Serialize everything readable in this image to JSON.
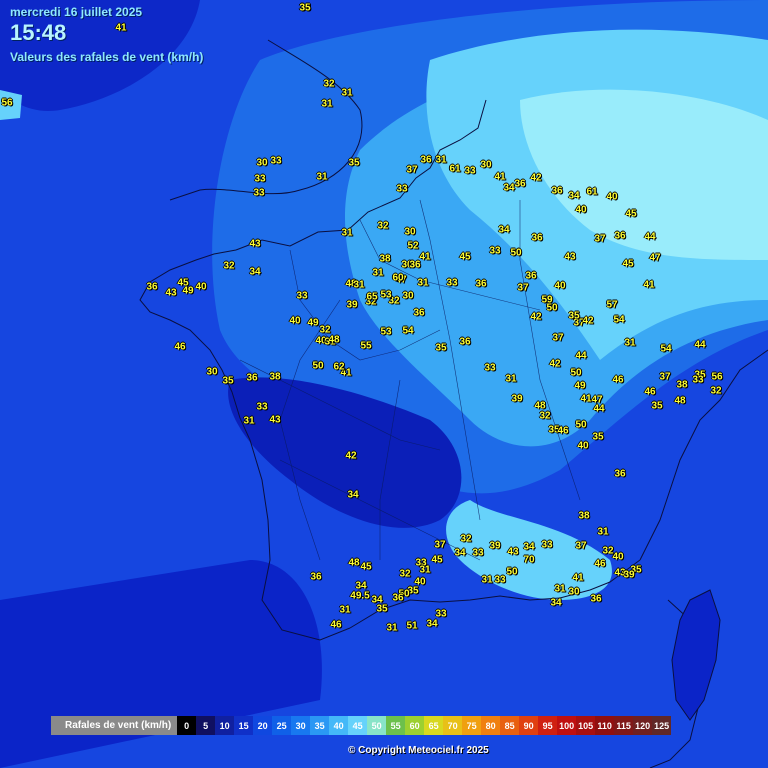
{
  "header": {
    "date": "mercredi 16 juillet 2025",
    "time": "15:48",
    "subtitle": "Valeurs des rafales de vent (km/h)"
  },
  "map": {
    "colors": {
      "sea": "#0a2fd6",
      "dark": "#0b1fb8",
      "mid": "#1e6ce8",
      "light": "#3aa8f4",
      "pale": "#66d2fb",
      "palest": "#99ecfb",
      "obs_text": "#ffff33"
    }
  },
  "observations": [
    {
      "v": "33"
    },
    {
      "v": "41"
    },
    {
      "v": "56"
    },
    {
      "v": "32"
    },
    {
      "v": "31"
    },
    {
      "v": "31"
    },
    {
      "v": "30"
    },
    {
      "v": "33"
    },
    {
      "v": "33"
    },
    {
      "v": "31"
    },
    {
      "v": "35"
    },
    {
      "v": "33"
    },
    {
      "v": "31"
    },
    {
      "v": "43"
    },
    {
      "v": "32"
    },
    {
      "v": "34"
    },
    {
      "v": "30"
    },
    {
      "v": "35"
    },
    {
      "v": "36"
    },
    {
      "v": "38"
    },
    {
      "v": "40"
    },
    {
      "v": "33"
    },
    {
      "v": "31"
    },
    {
      "v": "43"
    },
    {
      "v": "45"
    },
    {
      "v": "36"
    },
    {
      "v": "43"
    },
    {
      "v": "40"
    },
    {
      "v": "46"
    },
    {
      "v": "49"
    },
    {
      "v": "48"
    },
    {
      "v": "38"
    },
    {
      "v": "30"
    },
    {
      "v": "32"
    },
    {
      "v": "45"
    },
    {
      "v": "33"
    },
    {
      "v": "36"
    },
    {
      "v": "59"
    },
    {
      "v": "40"
    },
    {
      "v": "37"
    },
    {
      "v": "35"
    },
    {
      "v": "37"
    },
    {
      "v": "44"
    },
    {
      "v": "37"
    },
    {
      "v": "36"
    },
    {
      "v": "33"
    },
    {
      "v": "50"
    },
    {
      "v": "50"
    },
    {
      "v": "42"
    },
    {
      "v": "57"
    },
    {
      "v": "34"
    },
    {
      "v": "36"
    },
    {
      "v": "43"
    },
    {
      "v": "37"
    },
    {
      "v": "36"
    },
    {
      "v": "44"
    },
    {
      "v": "40"
    },
    {
      "v": "45"
    },
    {
      "v": "47"
    },
    {
      "v": "41"
    },
    {
      "v": "42"
    },
    {
      "v": "54"
    },
    {
      "v": "31"
    },
    {
      "v": "54"
    },
    {
      "v": "44"
    },
    {
      "v": "35"
    },
    {
      "v": "38"
    },
    {
      "v": "37"
    },
    {
      "v": "32"
    },
    {
      "v": "56"
    },
    {
      "v": "33"
    },
    {
      "v": "48"
    },
    {
      "v": "35"
    },
    {
      "v": "46"
    },
    {
      "v": "44"
    },
    {
      "v": "46"
    },
    {
      "v": "47"
    },
    {
      "v": "49"
    },
    {
      "v": "50"
    },
    {
      "v": "42"
    },
    {
      "v": "36"
    },
    {
      "v": "35"
    },
    {
      "v": "33"
    },
    {
      "v": "31"
    },
    {
      "v": "39"
    },
    {
      "v": "32"
    },
    {
      "v": "48"
    },
    {
      "v": "35"
    },
    {
      "v": "46"
    },
    {
      "v": "41"
    },
    {
      "v": "50"
    },
    {
      "v": "35"
    },
    {
      "v": "40"
    },
    {
      "v": "36"
    },
    {
      "v": "38"
    },
    {
      "v": "37"
    },
    {
      "v": "46"
    },
    {
      "v": "43"
    },
    {
      "v": "35"
    },
    {
      "v": "41"
    },
    {
      "v": "31"
    },
    {
      "v": "30"
    },
    {
      "v": "34"
    },
    {
      "v": "36"
    },
    {
      "v": "40"
    },
    {
      "v": "39"
    },
    {
      "v": "32"
    },
    {
      "v": "31"
    },
    {
      "v": "33"
    },
    {
      "v": "34"
    },
    {
      "v": "70"
    },
    {
      "v": "50"
    },
    {
      "v": "33"
    },
    {
      "v": "31"
    },
    {
      "v": "43"
    },
    {
      "v": "39"
    },
    {
      "v": "33"
    },
    {
      "v": "34"
    },
    {
      "v": "32"
    },
    {
      "v": "37"
    },
    {
      "v": "45"
    },
    {
      "v": "33"
    },
    {
      "v": "31"
    },
    {
      "v": "32"
    },
    {
      "v": "40"
    },
    {
      "v": "35"
    },
    {
      "v": "50"
    },
    {
      "v": "34"
    },
    {
      "v": "33"
    },
    {
      "v": "34"
    },
    {
      "v": "51"
    },
    {
      "v": "31"
    },
    {
      "v": "36"
    },
    {
      "v": "35"
    },
    {
      "v": "34"
    },
    {
      "v": "45"
    },
    {
      "v": "48"
    },
    {
      "v": "49.5"
    },
    {
      "v": "46"
    },
    {
      "v": "31"
    },
    {
      "v": "36"
    },
    {
      "v": "34"
    },
    {
      "v": "42"
    },
    {
      "v": "41"
    },
    {
      "v": "31"
    },
    {
      "v": "33"
    },
    {
      "v": "40"
    },
    {
      "v": "49"
    },
    {
      "v": "32"
    },
    {
      "v": "48"
    },
    {
      "v": "50"
    },
    {
      "v": "62"
    },
    {
      "v": "55"
    },
    {
      "v": "53"
    },
    {
      "v": "54"
    },
    {
      "v": "36"
    },
    {
      "v": "32"
    },
    {
      "v": "30"
    },
    {
      "v": "31"
    },
    {
      "v": "41"
    },
    {
      "v": "36"
    },
    {
      "v": "47"
    },
    {
      "v": "53"
    },
    {
      "v": "65"
    },
    {
      "v": "39"
    },
    {
      "v": "31"
    },
    {
      "v": "31"
    },
    {
      "v": "60"
    },
    {
      "v": "52"
    },
    {
      "v": "30"
    },
    {
      "v": "32"
    },
    {
      "v": "33"
    },
    {
      "v": "37"
    },
    {
      "v": "36"
    },
    {
      "v": "31"
    },
    {
      "v": "61"
    },
    {
      "v": "33"
    },
    {
      "v": "30"
    },
    {
      "v": "41"
    },
    {
      "v": "34"
    },
    {
      "v": "36"
    },
    {
      "v": "42"
    },
    {
      "v": "36"
    },
    {
      "v": "34"
    },
    {
      "v": "61"
    },
    {
      "v": "40"
    },
    {
      "v": "45"
    },
    {
      "v": "35"
    }
  ],
  "legend": {
    "title": "Rafales de vent (km/h)",
    "steps": [
      {
        "label": "0",
        "color": "#000000"
      },
      {
        "label": "5",
        "color": "#101060"
      },
      {
        "label": "10",
        "color": "#1020a0"
      },
      {
        "label": "15",
        "color": "#1030c8"
      },
      {
        "label": "20",
        "color": "#1048e0"
      },
      {
        "label": "25",
        "color": "#1060e8"
      },
      {
        "label": "30",
        "color": "#1878f0"
      },
      {
        "label": "35",
        "color": "#2a98f4"
      },
      {
        "label": "40",
        "color": "#44b8f8"
      },
      {
        "label": "45",
        "color": "#66d2fb"
      },
      {
        "label": "50",
        "color": "#88e4c8"
      },
      {
        "label": "55",
        "color": "#6cc04c"
      },
      {
        "label": "60",
        "color": "#9cd030"
      },
      {
        "label": "65",
        "color": "#d8d820"
      },
      {
        "label": "70",
        "color": "#e8c018"
      },
      {
        "label": "75",
        "color": "#f0a010"
      },
      {
        "label": "80",
        "color": "#f08010"
      },
      {
        "label": "85",
        "color": "#e86010"
      },
      {
        "label": "90",
        "color": "#e04010"
      },
      {
        "label": "95",
        "color": "#d02010"
      },
      {
        "label": "100",
        "color": "#c01010"
      },
      {
        "label": "105",
        "color": "#a81010"
      },
      {
        "label": "110",
        "color": "#901010"
      },
      {
        "label": "115",
        "color": "#801818"
      },
      {
        "label": "120",
        "color": "#702020"
      },
      {
        "label": "125",
        "color": "#602828"
      }
    ]
  },
  "footer": {
    "copyright": "© Copyright Meteociel.fr 2025"
  }
}
